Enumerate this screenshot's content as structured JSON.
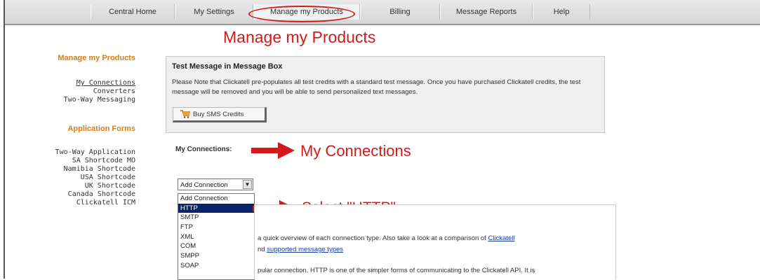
{
  "nav": {
    "items": [
      {
        "label": "Central Home"
      },
      {
        "label": "My Settings"
      },
      {
        "label": "Manage my Products"
      },
      {
        "label": "Billing"
      },
      {
        "label": "Message Reports"
      },
      {
        "label": "Help"
      }
    ],
    "active": "Manage my Products"
  },
  "page_title": "Manage my Products",
  "sidebar": {
    "section1_heading": "Manage my Products",
    "section1_links": [
      "My Connections",
      "Converters",
      "Two-Way Messaging"
    ],
    "section2_heading": "Application Forms",
    "section2_links": [
      "Two-Way Application",
      "SA Shortcode MO",
      "Namibia Shortcode",
      "USA Shortcode",
      "UK Shortcode",
      "Canada Shortcode",
      "Clickatell ICM"
    ]
  },
  "message_box": {
    "title": "Test Message in Message Box",
    "text": "Please Note that Clickatell pre-populates all test credits with a standard test message. Once you have purchased Clickatell credits, the test message will be removed and you will be able to send personalized text messages.",
    "buy_button": "Buy SMS Credits"
  },
  "connections": {
    "label": "My Connections:",
    "annotation": "My Connections",
    "select_value": "Add Connection",
    "options": [
      "Add Connection",
      "HTTP",
      "SMTP",
      "FTP",
      "XML",
      "COM",
      "SMPP",
      "SOAP"
    ],
    "selected_option": "HTTP",
    "select_annotation": "Select \"HTTP\"."
  },
  "info": {
    "line1_text": "a quick overview of each connection type. Also take a look at a comparison of",
    "line1_link": "Clickatell",
    "line2_pre": "nd",
    "line2_link": "supported message types",
    "line3_text": "pular connection. HTTP is one of the simpler forms of communicating to the Clickatell API. It is"
  },
  "colors": {
    "annotation_red": "#d21a1a",
    "sidebar_orange": "#e07b12",
    "dropdown_highlight": "#0a246a",
    "link_blue": "#1a3ea8"
  },
  "icons": {
    "cart": "shopping-cart-icon",
    "arrow": "right-arrow-icon",
    "dropdown": "chevron-down-icon"
  }
}
